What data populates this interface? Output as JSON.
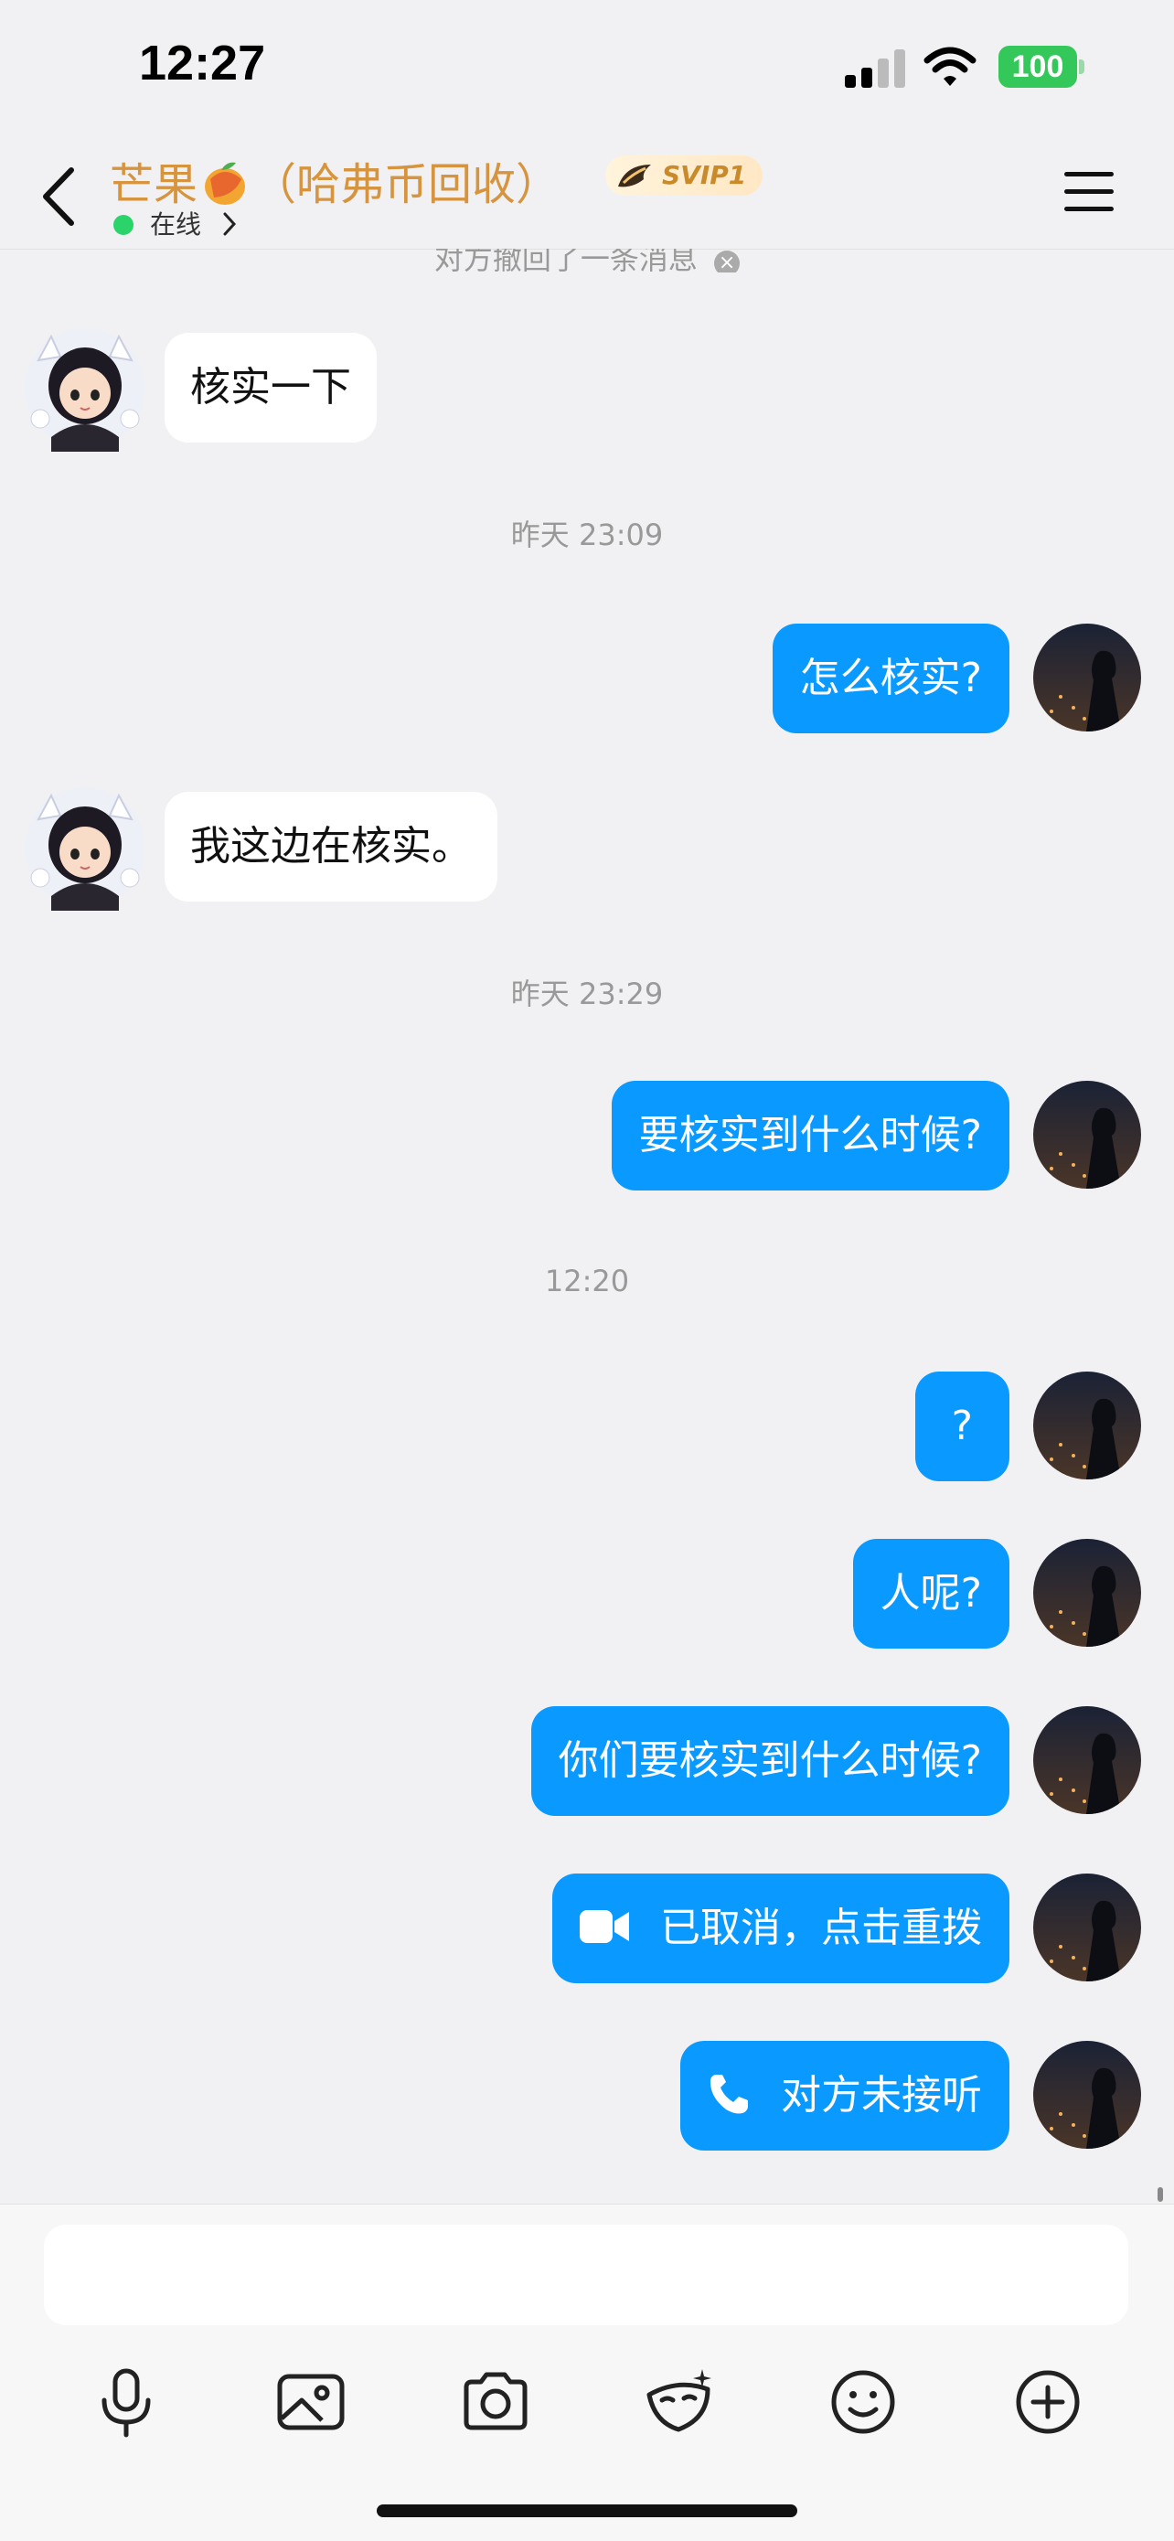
{
  "status_bar": {
    "time": "12:27",
    "battery": "100"
  },
  "header": {
    "name_prefix": "芒果",
    "name_suffix": "（哈弗币回收）",
    "badge": "SVIP1",
    "status": "在线"
  },
  "recall_notice": "对方撤回了一条消息",
  "messages": [
    {
      "from": "them",
      "text": "核实一下"
    },
    {
      "timestamp": "昨天 23:09"
    },
    {
      "from": "me",
      "text": "怎么核实?"
    },
    {
      "from": "them",
      "text": "我这边在核实。"
    },
    {
      "timestamp": "昨天 23:29"
    },
    {
      "from": "me",
      "text": "要核实到什么时候?"
    },
    {
      "timestamp": "12:20"
    },
    {
      "from": "me",
      "text": "?"
    },
    {
      "from": "me",
      "text": "人呢?"
    },
    {
      "from": "me",
      "text": "你们要核实到什么时候?"
    },
    {
      "from": "me",
      "type": "video-call",
      "icon": "video-camera-icon",
      "text": "已取消，点击重拨"
    },
    {
      "from": "me",
      "type": "voice-call",
      "icon": "phone-icon",
      "text": "对方未接听"
    }
  ],
  "composer": {
    "input_value": "",
    "tools": [
      "microphone-icon",
      "image-icon",
      "camera-icon",
      "mask-icon",
      "emoji-icon",
      "plus-icon"
    ]
  },
  "colors": {
    "accent_blue": "#0a99ff",
    "title_gold": "#d6943e",
    "online_green": "#2bd36b",
    "battery_green": "#34c759"
  }
}
